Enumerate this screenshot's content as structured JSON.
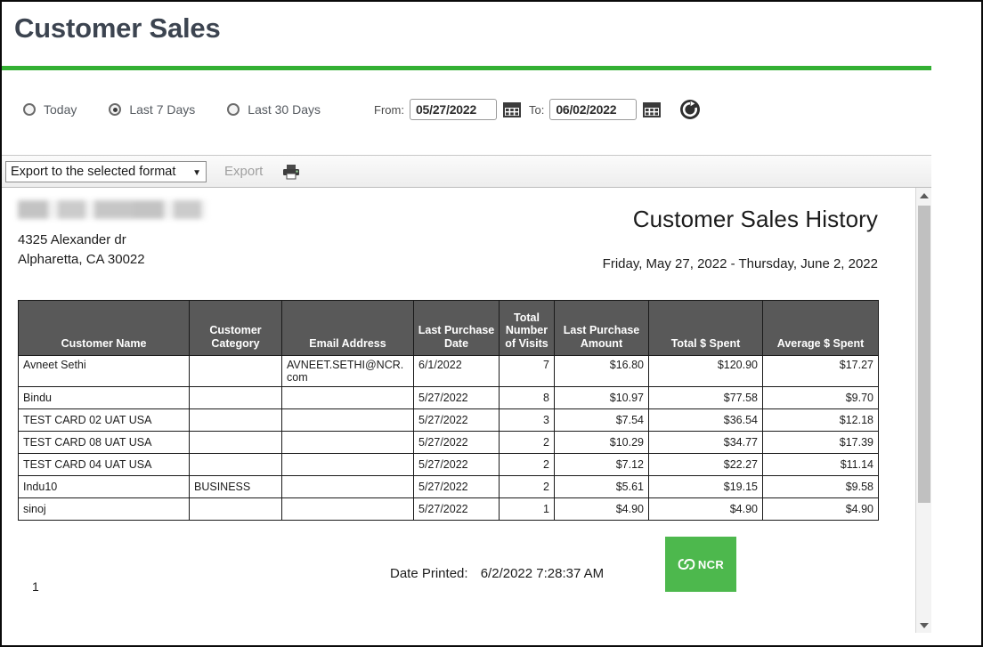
{
  "page": {
    "title": "Customer Sales",
    "accent_color": "#33b033"
  },
  "filters": {
    "radios": [
      {
        "label": "Today",
        "selected": false
      },
      {
        "label": "Last 7 Days",
        "selected": true
      },
      {
        "label": "Last 30 Days",
        "selected": false
      }
    ],
    "from_label": "From:",
    "from_value": "05/27/2022",
    "to_label": "To:",
    "to_value": "06/02/2022",
    "calendar_icon": "calendar-icon",
    "refresh_icon": "refresh-icon"
  },
  "toolbar": {
    "export_select_value": "Export to the selected format",
    "export_select_options": [
      "Export to the selected format"
    ],
    "export_button_label": "Export",
    "print_icon": "printer-icon"
  },
  "report": {
    "company_name_redacted": "",
    "address_line1": "4325 Alexander dr",
    "address_line2": "Alpharetta, CA 30022",
    "title": "Customer Sales History",
    "date_range": "Friday, May 27, 2022 - Thursday, June 2, 2022",
    "columns": [
      "Customer Name",
      "Customer\nCategory",
      "Email Address",
      "Last Purchase\nDate",
      "Total\nNumber\nof Visits",
      "Last Purchase\nAmount",
      "Total $ Spent",
      "Average $ Spent"
    ],
    "rows": [
      {
        "customer_name": "Avneet Sethi",
        "customer_category": "",
        "email": "AVNEET.SETHI@NCR.com",
        "last_purchase_date": "6/1/2022",
        "visits": "7",
        "last_purchase_amount": "$16.80",
        "total_spent": "$120.90",
        "average_spent": "$17.27"
      },
      {
        "customer_name": "Bindu",
        "customer_category": "",
        "email": "",
        "last_purchase_date": "5/27/2022",
        "visits": "8",
        "last_purchase_amount": "$10.97",
        "total_spent": "$77.58",
        "average_spent": "$9.70"
      },
      {
        "customer_name": "TEST CARD 02 UAT USA",
        "customer_category": "",
        "email": "",
        "last_purchase_date": "5/27/2022",
        "visits": "3",
        "last_purchase_amount": "$7.54",
        "total_spent": "$36.54",
        "average_spent": "$12.18"
      },
      {
        "customer_name": "TEST CARD 08 UAT USA",
        "customer_category": "",
        "email": "",
        "last_purchase_date": "5/27/2022",
        "visits": "2",
        "last_purchase_amount": "$10.29",
        "total_spent": "$34.77",
        "average_spent": "$17.39"
      },
      {
        "customer_name": "TEST CARD 04 UAT USA",
        "customer_category": "",
        "email": "",
        "last_purchase_date": "5/27/2022",
        "visits": "2",
        "last_purchase_amount": "$7.12",
        "total_spent": "$22.27",
        "average_spent": "$11.14"
      },
      {
        "customer_name": "Indu10",
        "customer_category": "BUSINESS",
        "email": "",
        "last_purchase_date": "5/27/2022",
        "visits": "2",
        "last_purchase_amount": "$5.61",
        "total_spent": "$19.15",
        "average_spent": "$9.58"
      },
      {
        "customer_name": "sinoj",
        "customer_category": "",
        "email": "",
        "last_purchase_date": "5/27/2022",
        "visits": "1",
        "last_purchase_amount": "$4.90",
        "total_spent": "$4.90",
        "average_spent": "$4.90"
      }
    ],
    "footer": {
      "date_printed_label": "Date Printed:",
      "date_printed_value": "6/2/2022 7:28:37 AM",
      "page_number": "1",
      "logo_text": "NCR",
      "logo_color": "#4db84d"
    }
  },
  "scrollbar": {
    "up_icon": "scroll-up-arrow-icon",
    "down_icon": "scroll-down-arrow-icon"
  }
}
